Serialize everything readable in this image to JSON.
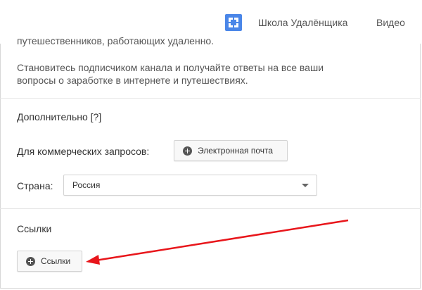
{
  "topbar": {
    "channel_name": "Школа Удалёнщика",
    "video_tab": "Видео",
    "channel_icon": "channel-logo-icon"
  },
  "description": {
    "line1": "путешественников, работающих удаленно.",
    "line2": "Становитесь подписчиком канала и получайте ответы на все ваши",
    "line3": "вопросы о заработке в интернете и путешествиях."
  },
  "additional": {
    "title": "Дополнительно [?]",
    "business_label": "Для коммерческих запросов:",
    "email_button": "Электронная почта",
    "country_label": "Страна:",
    "country_value": "Россия"
  },
  "links": {
    "title": "Ссылки",
    "button": "Ссылки"
  },
  "annotation": {
    "color": "#e8161b"
  }
}
